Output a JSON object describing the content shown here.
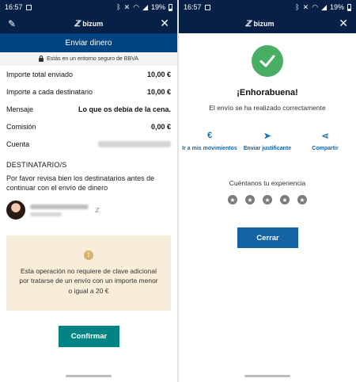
{
  "left": {
    "statusbar": {
      "time": "16:57",
      "battery": "19%"
    },
    "appbar": {
      "brand": "bizum",
      "brand_mark": "ℤ"
    },
    "subheader": "Enviar dinero",
    "secure_text": "Estás en un entorno seguro de BBVA",
    "rows": [
      {
        "label": "Importe total enviado",
        "value": "10,00 €"
      },
      {
        "label": "Importe a cada destinatario",
        "value": "10,00 €"
      },
      {
        "label": "Mensaje",
        "value": "Lo que os debía de la cena."
      },
      {
        "label": "Comisión",
        "value": "0,00 €"
      },
      {
        "label": "Cuenta",
        "value": ""
      }
    ],
    "recipients_title": "DESTINATARIO/S",
    "recipients_text": "Por favor revisa bien los destinatarios antes de continuar con el envío de dinero",
    "notice_text": "Esta operación no requiere de clave adicional por tratarse de un envío con un importe menor o igual a 20 €",
    "confirm_label": "Confirmar"
  },
  "right": {
    "statusbar": {
      "time": "16:57",
      "battery": "19%"
    },
    "appbar": {
      "brand": "bizum",
      "brand_mark": "ℤ"
    },
    "title": "¡Enhorabuena!",
    "subtitle": "El envío se ha realizado correctamente",
    "actions": [
      {
        "icon": "euro-circle-icon",
        "label": "Ir a mis movimientos"
      },
      {
        "icon": "send-icon",
        "label": "Enviar justificante"
      },
      {
        "icon": "share-icon",
        "label": "Compartir"
      }
    ],
    "experience_label": "Cuéntanos tu experiencia",
    "close_label": "Cerrar"
  },
  "colors": {
    "navy": "#072146",
    "blue": "#004481",
    "teal": "#028484",
    "action_blue": "#1464a5",
    "success_green": "#48ae64",
    "notice_bg": "#f8edd8"
  }
}
